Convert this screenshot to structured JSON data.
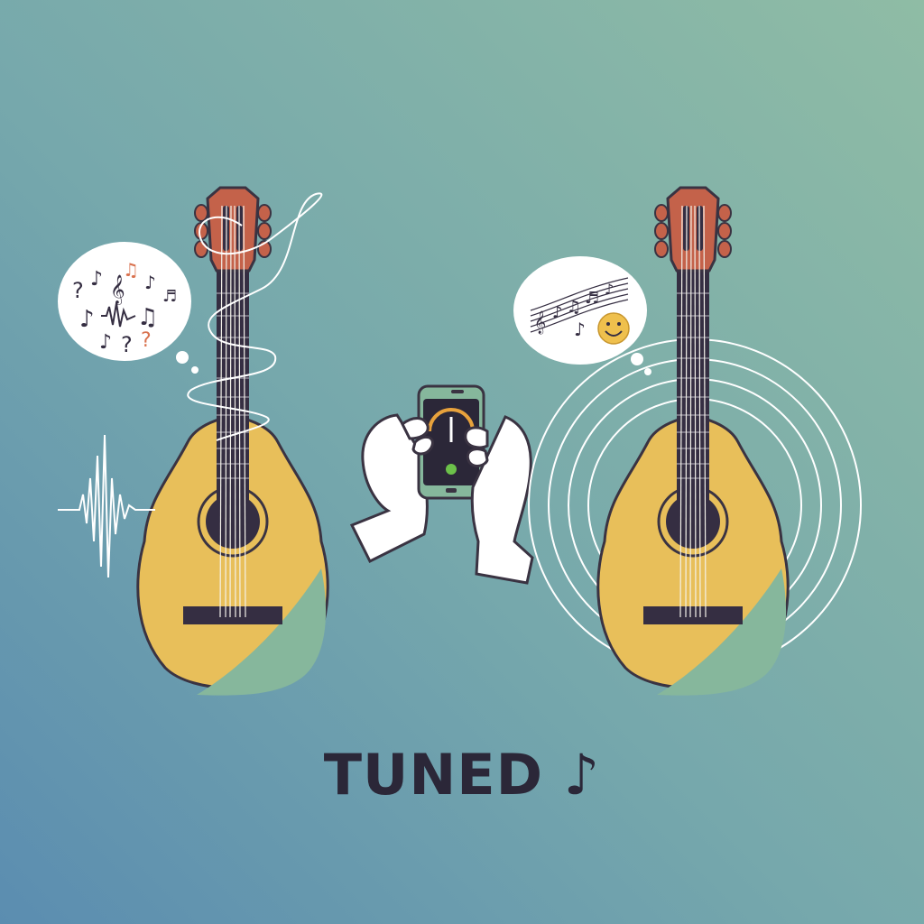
{
  "caption": {
    "word": "TUNED",
    "glyph": "♪"
  },
  "palette": {
    "bg_top_right": "#8fbca5",
    "bg_bottom_left": "#5b8db0",
    "guitar_body": "#e8bf5a",
    "guitar_body_shadow": "#86b79c",
    "headstock": "#c4624a",
    "fretboard": "#352e42",
    "outline": "#3a3342",
    "text": "#2b2738",
    "tuner_needle": "#e8a23c",
    "tuner_led": "#6cc14a",
    "question_accent": "#d9724f",
    "smiley": "#efc04d"
  },
  "icons": {
    "left_bubble": [
      "question-mark-icon",
      "music-note-icon",
      "treble-clef-icon",
      "noise-wave-icon"
    ],
    "right_bubble": [
      "music-staff-icon",
      "smiley-icon"
    ],
    "phone": "tuner-app-icon"
  }
}
